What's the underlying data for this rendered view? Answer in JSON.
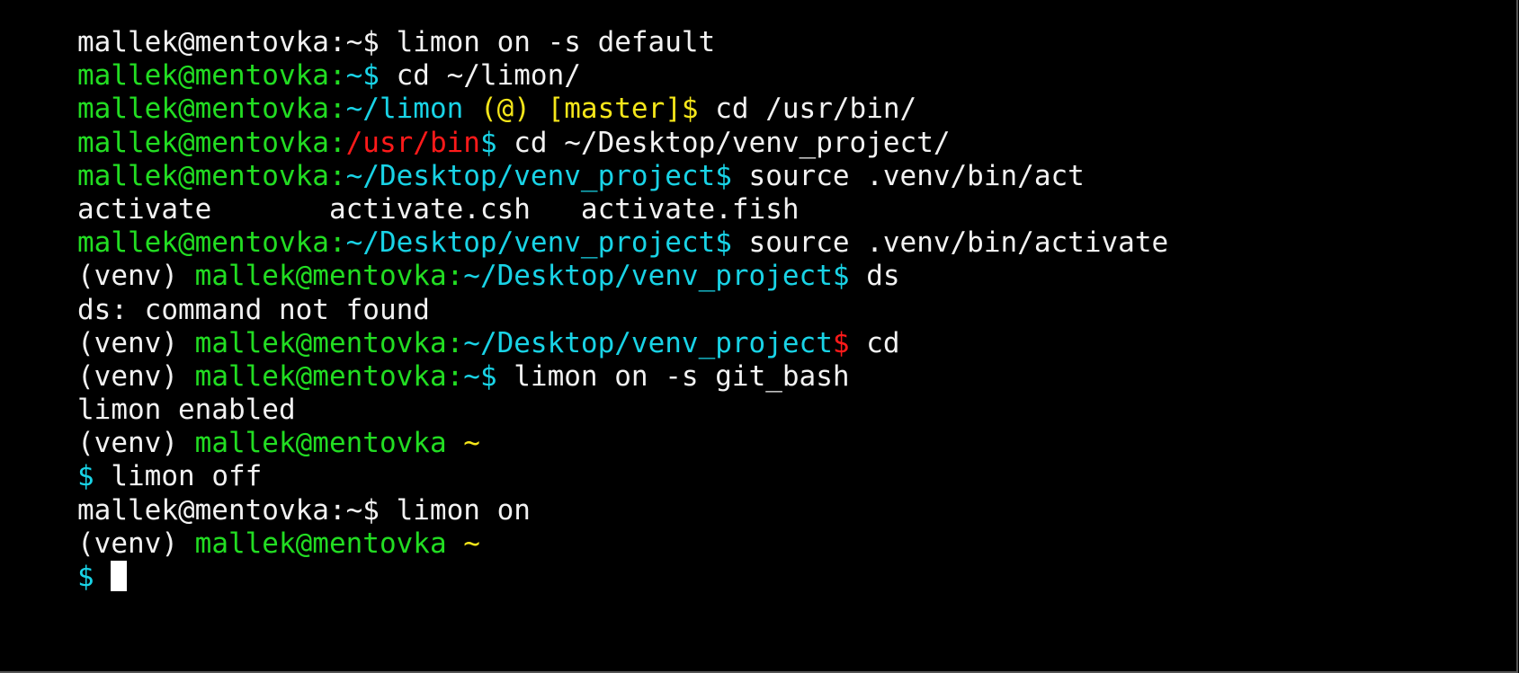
{
  "colors": {
    "white": "#f2f2f2",
    "green": "#22dd22",
    "cyan": "#19d3e6",
    "yellow": "#f5e61a",
    "red": "#ff1a1a"
  },
  "terminal": {
    "lines": [
      [
        {
          "t": "mallek@mentovka:~$ limon on -s default",
          "c": "white"
        }
      ],
      [
        {
          "t": "mallek@mentovka:",
          "c": "green"
        },
        {
          "t": "~$",
          "c": "cyan"
        },
        {
          "t": " cd ~/limon/",
          "c": "white"
        }
      ],
      [
        {
          "t": "mallek@mentovka:",
          "c": "green"
        },
        {
          "t": "~/limon ",
          "c": "cyan"
        },
        {
          "t": "(@) [master]$",
          "c": "yellow"
        },
        {
          "t": " cd /usr/bin/",
          "c": "white"
        }
      ],
      [
        {
          "t": "mallek@mentovka:",
          "c": "green"
        },
        {
          "t": "/usr/bin",
          "c": "red"
        },
        {
          "t": "$",
          "c": "cyan"
        },
        {
          "t": " cd ~/Desktop/venv_project/",
          "c": "white"
        }
      ],
      [
        {
          "t": "mallek@mentovka:",
          "c": "green"
        },
        {
          "t": "~/Desktop/venv_project$",
          "c": "cyan"
        },
        {
          "t": " source .venv/bin/act",
          "c": "white"
        }
      ],
      [
        {
          "t": "activate       activate.csh   activate.fish",
          "c": "white"
        }
      ],
      [
        {
          "t": "mallek@mentovka:",
          "c": "green"
        },
        {
          "t": "~/Desktop/venv_project$",
          "c": "cyan"
        },
        {
          "t": " source .venv/bin/activate",
          "c": "white"
        }
      ],
      [
        {
          "t": "(venv) ",
          "c": "white"
        },
        {
          "t": "mallek@mentovka:",
          "c": "green"
        },
        {
          "t": "~/Desktop/venv_project$",
          "c": "cyan"
        },
        {
          "t": " ds",
          "c": "white"
        }
      ],
      [
        {
          "t": "ds: command not found",
          "c": "white"
        }
      ],
      [
        {
          "t": "(venv) ",
          "c": "white"
        },
        {
          "t": "mallek@mentovka:",
          "c": "green"
        },
        {
          "t": "~/Desktop/venv_project",
          "c": "cyan"
        },
        {
          "t": "$",
          "c": "red"
        },
        {
          "t": " cd",
          "c": "white"
        }
      ],
      [
        {
          "t": "(venv) ",
          "c": "white"
        },
        {
          "t": "mallek@mentovka:",
          "c": "green"
        },
        {
          "t": "~$",
          "c": "cyan"
        },
        {
          "t": " limon on -s git_bash",
          "c": "white"
        }
      ],
      [
        {
          "t": "limon enabled",
          "c": "white"
        }
      ],
      [
        {
          "t": "(venv) ",
          "c": "white"
        },
        {
          "t": "mallek@mentovka ",
          "c": "green"
        },
        {
          "t": "~",
          "c": "yellow"
        }
      ],
      [
        {
          "t": "$",
          "c": "cyan"
        },
        {
          "t": " limon off",
          "c": "white"
        }
      ],
      [
        {
          "t": "mallek@mentovka:~$ limon on",
          "c": "white"
        }
      ],
      [
        {
          "t": "(venv) ",
          "c": "white"
        },
        {
          "t": "mallek@mentovka ",
          "c": "green"
        },
        {
          "t": "~",
          "c": "yellow"
        }
      ],
      [
        {
          "t": "$",
          "c": "cyan"
        },
        {
          "t": " ",
          "c": "white"
        }
      ]
    ]
  }
}
